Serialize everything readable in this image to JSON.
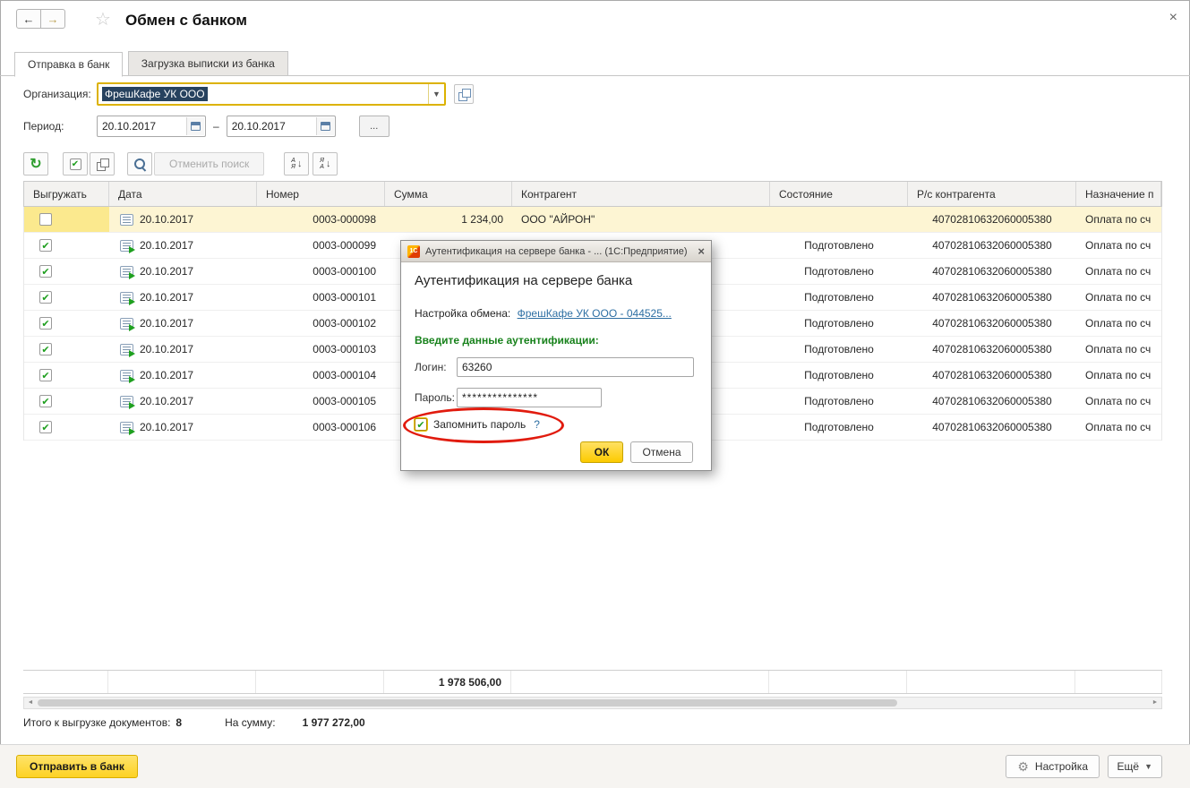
{
  "header": {
    "title": "Обмен с банком"
  },
  "icons": {
    "back": "←",
    "forward": "→",
    "star": "☆",
    "close": "×",
    "combo_arrow": "▼",
    "refresh": "↻",
    "check": "✔",
    "sort_letter_a": "А",
    "sort_letter_ya": "Я",
    "sort_arrow": "↓",
    "gear": "⚙",
    "more_arrow": "▼",
    "one_c": "1С",
    "scroll_left": "◄",
    "scroll_right": "►"
  },
  "colors": {
    "accent_yellow": "#fcd200",
    "focus_border": "#dcb200",
    "current_row": "#fdf5d3",
    "selection": "#27425f",
    "link": "#2e6fa3",
    "prompt_green": "#18821c",
    "annotation_red": "#e11b0e"
  },
  "tabs": [
    {
      "label": "Отправка в банк",
      "active": true
    },
    {
      "label": "Загрузка выписки из банка",
      "active": false
    }
  ],
  "form": {
    "org_label": "Организация:",
    "org_value": "ФрешКафе УК ООО",
    "period_label": "Период:",
    "period_from": "20.10.2017",
    "period_dash": "–",
    "period_to": "20.10.2017",
    "more_button": "..."
  },
  "toolbar": {
    "cancel_search_label": "Отменить поиск"
  },
  "table": {
    "columns": [
      "Выгружать",
      "Дата",
      "Номер",
      "Сумма",
      "Контрагент",
      "Состояние",
      "Р/с контрагента",
      "Назначение п"
    ],
    "rows": [
      {
        "checked": false,
        "current": true,
        "date": "20.10.2017",
        "number": "0003-000098",
        "sum": "1 234,00",
        "contractor": "ООО \"АЙРОН\"",
        "status": "",
        "account": "40702810632060005380",
        "purpose": "Оплата по сч"
      },
      {
        "checked": true,
        "current": false,
        "date": "20.10.2017",
        "number": "0003-000099",
        "sum": "",
        "contractor": "",
        "status": "Подготовлено",
        "account": "40702810632060005380",
        "purpose": "Оплата по сч"
      },
      {
        "checked": true,
        "current": false,
        "date": "20.10.2017",
        "number": "0003-000100",
        "sum": "",
        "contractor": "",
        "status": "Подготовлено",
        "account": "40702810632060005380",
        "purpose": "Оплата по сч"
      },
      {
        "checked": true,
        "current": false,
        "date": "20.10.2017",
        "number": "0003-000101",
        "sum": "",
        "contractor": "",
        "status": "Подготовлено",
        "account": "40702810632060005380",
        "purpose": "Оплата по сч"
      },
      {
        "checked": true,
        "current": false,
        "date": "20.10.2017",
        "number": "0003-000102",
        "sum": "",
        "contractor": "",
        "status": "Подготовлено",
        "account": "40702810632060005380",
        "purpose": "Оплата по сч"
      },
      {
        "checked": true,
        "current": false,
        "date": "20.10.2017",
        "number": "0003-000103",
        "sum": "",
        "contractor": "",
        "status": "Подготовлено",
        "account": "40702810632060005380",
        "purpose": "Оплата по сч"
      },
      {
        "checked": true,
        "current": false,
        "date": "20.10.2017",
        "number": "0003-000104",
        "sum": "",
        "contractor": "",
        "status": "Подготовлено",
        "account": "40702810632060005380",
        "purpose": "Оплата по сч"
      },
      {
        "checked": true,
        "current": false,
        "date": "20.10.2017",
        "number": "0003-000105",
        "sum": "",
        "contractor": "",
        "status": "Подготовлено",
        "account": "40702810632060005380",
        "purpose": "Оплата по сч"
      },
      {
        "checked": true,
        "current": false,
        "date": "20.10.2017",
        "number": "0003-000106",
        "sum": "",
        "contractor": "",
        "status": "Подготовлено",
        "account": "40702810632060005380",
        "purpose": "Оплата по сч"
      }
    ],
    "total_sum": "1 978 506,00"
  },
  "status": {
    "total_label": "Итого к выгрузке документов:",
    "total_count": "8",
    "sum_label": "На сумму:",
    "sum_value": "1 977 272,00"
  },
  "footer": {
    "send_button": "Отправить в банк",
    "settings_button": "Настройка",
    "more_button": "Ещё"
  },
  "dialog": {
    "window_title": "Аутентификация на сервере банка - ... (1С:Предприятие)",
    "title": "Аутентификация на сервере банка",
    "settings_label": "Настройка обмена:",
    "settings_link": "ФрешКафе УК ООО - 044525...",
    "prompt": "Введите данные аутентификации:",
    "login_label": "Логин:",
    "login_value": "63260",
    "password_label": "Пароль:",
    "password_value": "***************",
    "remember_label": "Запомнить пароль",
    "help": "?",
    "ok": "ОК",
    "cancel": "Отмена"
  }
}
